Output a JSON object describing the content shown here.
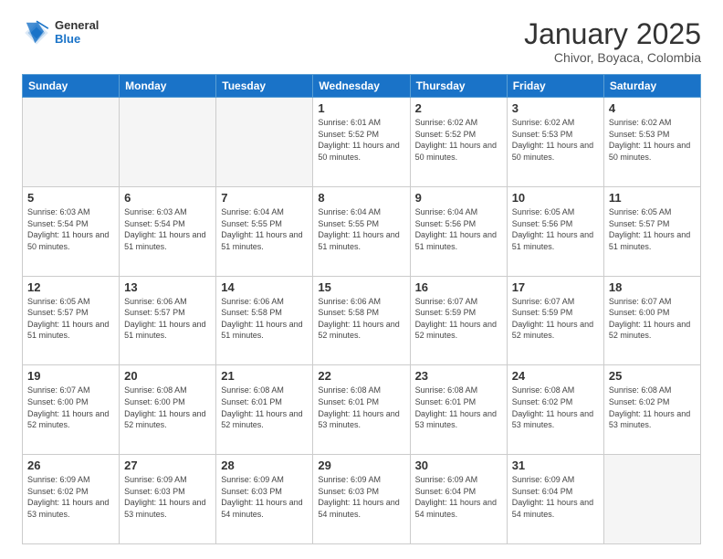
{
  "logo": {
    "general": "General",
    "blue": "Blue"
  },
  "header": {
    "month": "January 2025",
    "location": "Chivor, Boyaca, Colombia"
  },
  "weekdays": [
    "Sunday",
    "Monday",
    "Tuesday",
    "Wednesday",
    "Thursday",
    "Friday",
    "Saturday"
  ],
  "weeks": [
    [
      {
        "day": "",
        "info": ""
      },
      {
        "day": "",
        "info": ""
      },
      {
        "day": "",
        "info": ""
      },
      {
        "day": "1",
        "info": "Sunrise: 6:01 AM\nSunset: 5:52 PM\nDaylight: 11 hours and 50 minutes."
      },
      {
        "day": "2",
        "info": "Sunrise: 6:02 AM\nSunset: 5:52 PM\nDaylight: 11 hours and 50 minutes."
      },
      {
        "day": "3",
        "info": "Sunrise: 6:02 AM\nSunset: 5:53 PM\nDaylight: 11 hours and 50 minutes."
      },
      {
        "day": "4",
        "info": "Sunrise: 6:02 AM\nSunset: 5:53 PM\nDaylight: 11 hours and 50 minutes."
      }
    ],
    [
      {
        "day": "5",
        "info": "Sunrise: 6:03 AM\nSunset: 5:54 PM\nDaylight: 11 hours and 50 minutes."
      },
      {
        "day": "6",
        "info": "Sunrise: 6:03 AM\nSunset: 5:54 PM\nDaylight: 11 hours and 51 minutes."
      },
      {
        "day": "7",
        "info": "Sunrise: 6:04 AM\nSunset: 5:55 PM\nDaylight: 11 hours and 51 minutes."
      },
      {
        "day": "8",
        "info": "Sunrise: 6:04 AM\nSunset: 5:55 PM\nDaylight: 11 hours and 51 minutes."
      },
      {
        "day": "9",
        "info": "Sunrise: 6:04 AM\nSunset: 5:56 PM\nDaylight: 11 hours and 51 minutes."
      },
      {
        "day": "10",
        "info": "Sunrise: 6:05 AM\nSunset: 5:56 PM\nDaylight: 11 hours and 51 minutes."
      },
      {
        "day": "11",
        "info": "Sunrise: 6:05 AM\nSunset: 5:57 PM\nDaylight: 11 hours and 51 minutes."
      }
    ],
    [
      {
        "day": "12",
        "info": "Sunrise: 6:05 AM\nSunset: 5:57 PM\nDaylight: 11 hours and 51 minutes."
      },
      {
        "day": "13",
        "info": "Sunrise: 6:06 AM\nSunset: 5:57 PM\nDaylight: 11 hours and 51 minutes."
      },
      {
        "day": "14",
        "info": "Sunrise: 6:06 AM\nSunset: 5:58 PM\nDaylight: 11 hours and 51 minutes."
      },
      {
        "day": "15",
        "info": "Sunrise: 6:06 AM\nSunset: 5:58 PM\nDaylight: 11 hours and 52 minutes."
      },
      {
        "day": "16",
        "info": "Sunrise: 6:07 AM\nSunset: 5:59 PM\nDaylight: 11 hours and 52 minutes."
      },
      {
        "day": "17",
        "info": "Sunrise: 6:07 AM\nSunset: 5:59 PM\nDaylight: 11 hours and 52 minutes."
      },
      {
        "day": "18",
        "info": "Sunrise: 6:07 AM\nSunset: 6:00 PM\nDaylight: 11 hours and 52 minutes."
      }
    ],
    [
      {
        "day": "19",
        "info": "Sunrise: 6:07 AM\nSunset: 6:00 PM\nDaylight: 11 hours and 52 minutes."
      },
      {
        "day": "20",
        "info": "Sunrise: 6:08 AM\nSunset: 6:00 PM\nDaylight: 11 hours and 52 minutes."
      },
      {
        "day": "21",
        "info": "Sunrise: 6:08 AM\nSunset: 6:01 PM\nDaylight: 11 hours and 52 minutes."
      },
      {
        "day": "22",
        "info": "Sunrise: 6:08 AM\nSunset: 6:01 PM\nDaylight: 11 hours and 53 minutes."
      },
      {
        "day": "23",
        "info": "Sunrise: 6:08 AM\nSunset: 6:01 PM\nDaylight: 11 hours and 53 minutes."
      },
      {
        "day": "24",
        "info": "Sunrise: 6:08 AM\nSunset: 6:02 PM\nDaylight: 11 hours and 53 minutes."
      },
      {
        "day": "25",
        "info": "Sunrise: 6:08 AM\nSunset: 6:02 PM\nDaylight: 11 hours and 53 minutes."
      }
    ],
    [
      {
        "day": "26",
        "info": "Sunrise: 6:09 AM\nSunset: 6:02 PM\nDaylight: 11 hours and 53 minutes."
      },
      {
        "day": "27",
        "info": "Sunrise: 6:09 AM\nSunset: 6:03 PM\nDaylight: 11 hours and 53 minutes."
      },
      {
        "day": "28",
        "info": "Sunrise: 6:09 AM\nSunset: 6:03 PM\nDaylight: 11 hours and 54 minutes."
      },
      {
        "day": "29",
        "info": "Sunrise: 6:09 AM\nSunset: 6:03 PM\nDaylight: 11 hours and 54 minutes."
      },
      {
        "day": "30",
        "info": "Sunrise: 6:09 AM\nSunset: 6:04 PM\nDaylight: 11 hours and 54 minutes."
      },
      {
        "day": "31",
        "info": "Sunrise: 6:09 AM\nSunset: 6:04 PM\nDaylight: 11 hours and 54 minutes."
      },
      {
        "day": "",
        "info": ""
      }
    ]
  ]
}
